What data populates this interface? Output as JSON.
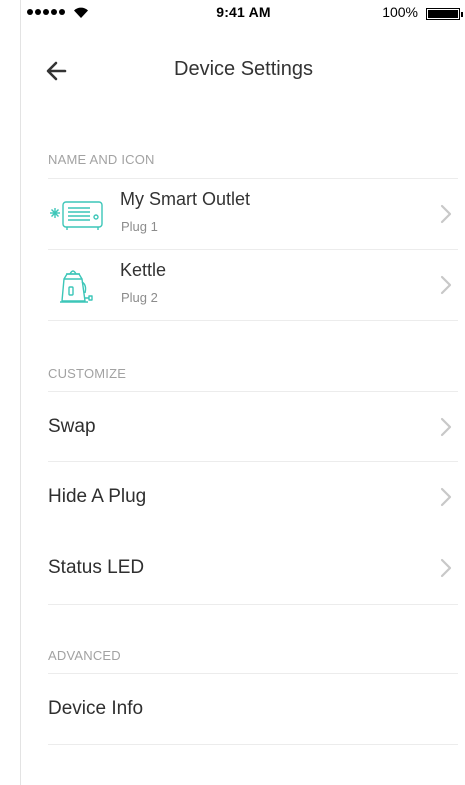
{
  "status_bar": {
    "time": "9:41 AM",
    "battery": "100%",
    "battery_level": 1.0,
    "signal_bars": 5
  },
  "header": {
    "title": "Device Settings",
    "back_icon": "arrow-left-icon"
  },
  "sections": {
    "name_and_icon": {
      "title": "NAME AND ICON",
      "devices": [
        {
          "name": "My Smart Outlet",
          "sub": "Plug 1",
          "icon": "heater-icon"
        },
        {
          "name": "Kettle",
          "sub": "Plug 2",
          "icon": "kettle-icon"
        }
      ]
    },
    "customize": {
      "title": "CUSTOMIZE",
      "items": [
        "Swap",
        "Hide A Plug",
        "Status LED"
      ]
    },
    "advanced": {
      "title": "ADVANCED",
      "items": [
        "Device Info"
      ]
    }
  },
  "colors": {
    "accent": "#3cc6b8",
    "divider": "#ececec",
    "section_header": "#a2a2a2",
    "chevron": "#c8c8c8"
  }
}
